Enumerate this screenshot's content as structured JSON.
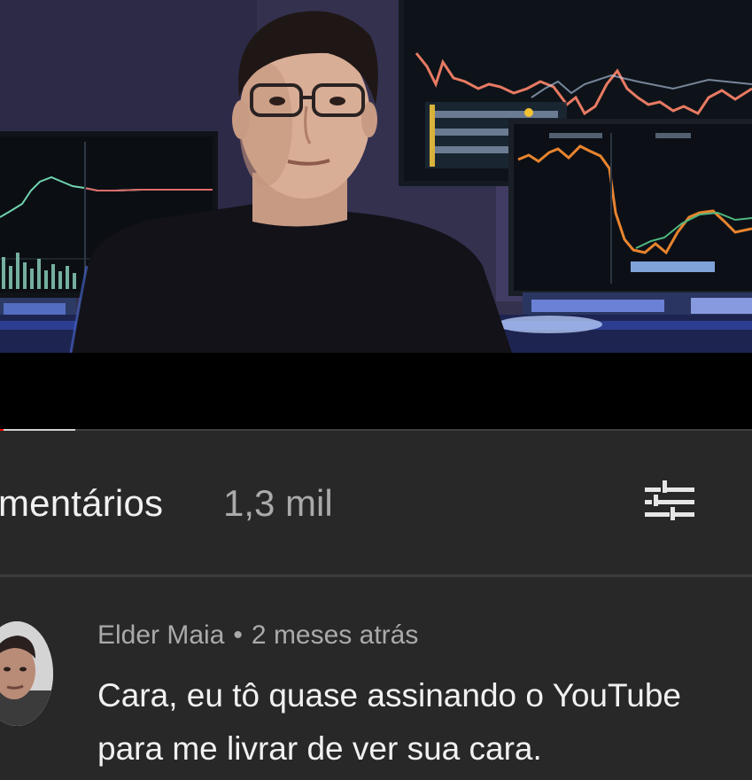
{
  "video": {
    "progress": {
      "played_fraction": 0.004,
      "buffered_fraction": 0.1
    },
    "colors": {
      "played": "#ff0000",
      "buffer": "#cfcfcf",
      "track": "#3d3d3d"
    }
  },
  "comments": {
    "title": "mentários",
    "count": "1,3 mil",
    "sort_icon": "sort-filter-icon"
  },
  "comment": {
    "author": "Elder Maia",
    "separator": "•",
    "time": "2 meses atrás",
    "text_lines": [
      "Cara, eu tô quase assinando o YouTube",
      "para me livrar de ver sua cara."
    ]
  }
}
